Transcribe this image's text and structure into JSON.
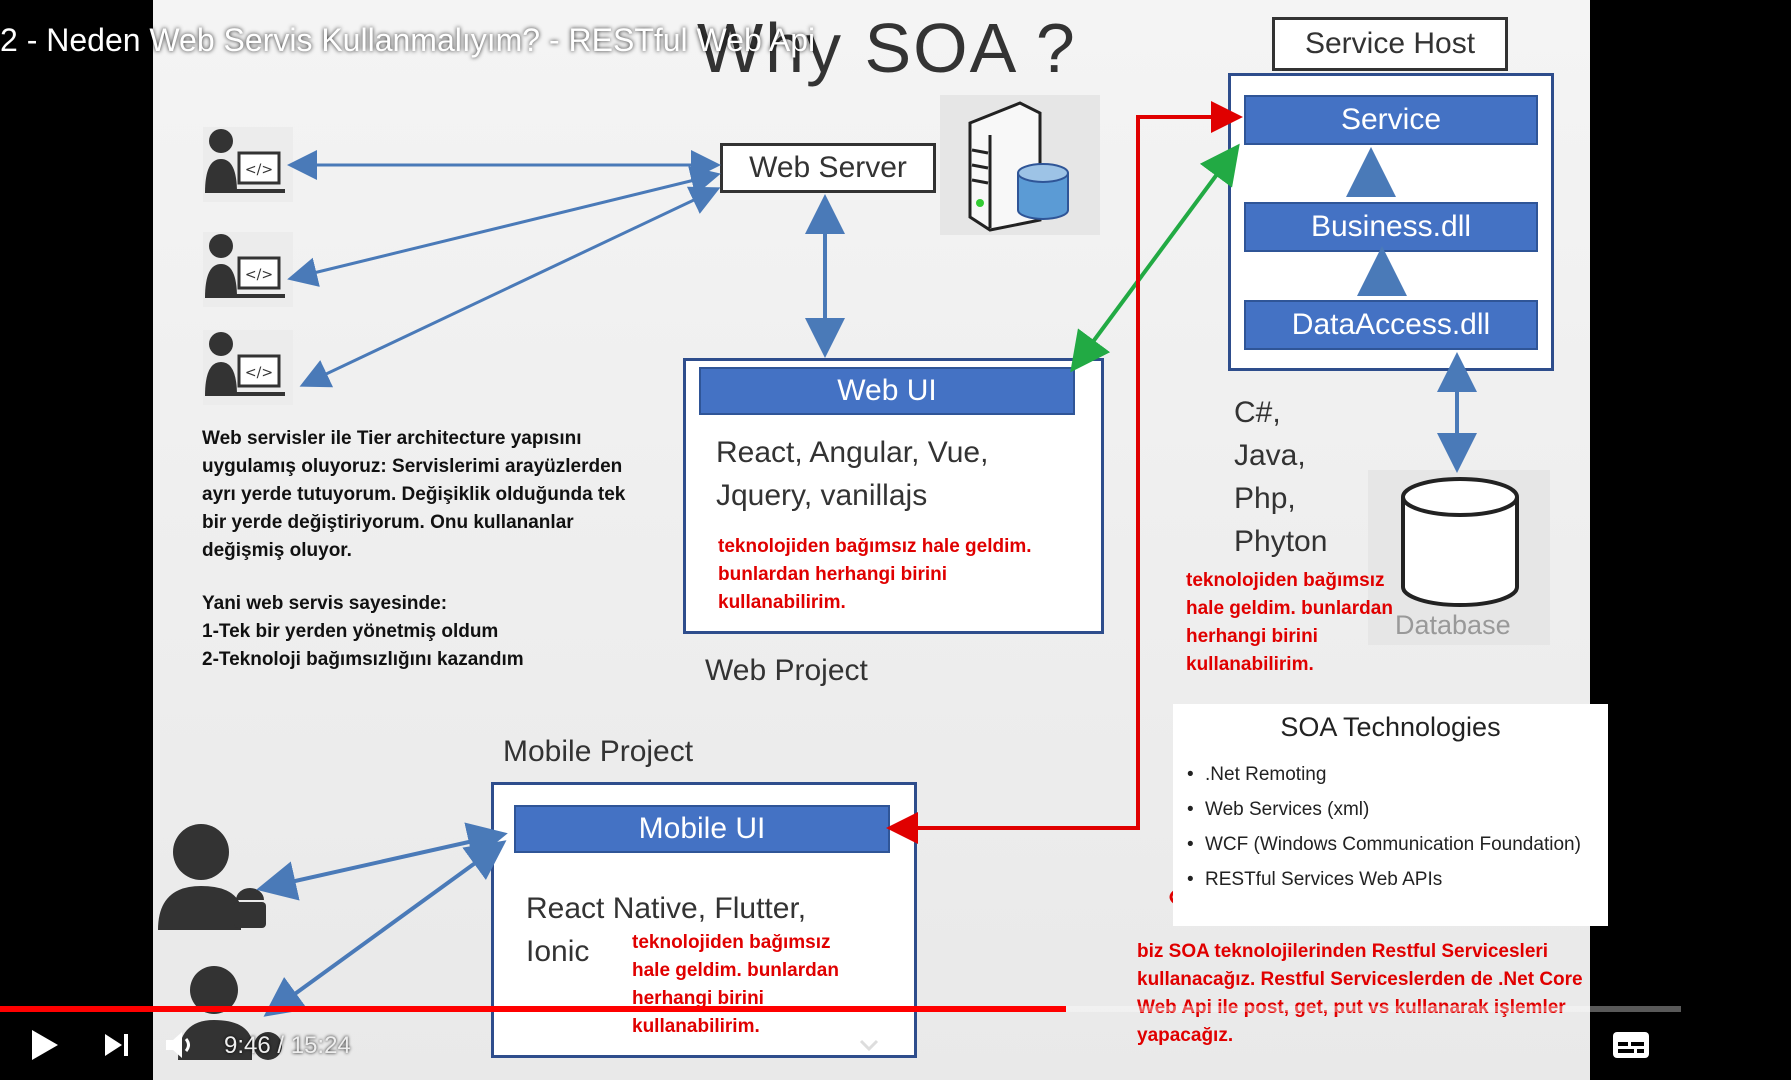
{
  "video": {
    "title": "2 - Neden Web Servis Kullanmalıyım? - RESTful Web Api",
    "current_time": "9:46",
    "separator": "/",
    "duration": "15:24",
    "progress_fraction": 0.634
  },
  "slide": {
    "heading": "Why SOA ?",
    "service_host": {
      "title": "Service Host",
      "service": "Service",
      "business": "Business.dll",
      "dataaccess": "DataAccess.dll"
    },
    "web_server": "Web Server",
    "web_project": {
      "ui": "Web UI",
      "tech_line1": "React, Angular, Vue,",
      "tech_line2": "Jquery, vanillajs",
      "label": "Web Project"
    },
    "mobile_project": {
      "label": "Mobile Project",
      "ui": "Mobile UI",
      "tech_line1": "React Native, Flutter,",
      "tech_line2": "Ionic"
    },
    "languages": [
      "C#,",
      "Java,",
      "Php,",
      "Phyton"
    ],
    "database": "Database",
    "soa_technologies": {
      "title": "SOA Technologies",
      "items": [
        ".Net Remoting",
        "Web Services (xml)",
        "WCF (Windows Communication Foundation)",
        "RESTful Services Web APIs"
      ]
    }
  },
  "notes": {
    "left_paragraph": [
      "Web servisler ile Tier architecture  yapısını",
      "uygulamış oluyoruz: Servislerimi arayüzlerden",
      "ayrı yerde tutuyorum. Değişiklik olduğunda tek",
      "bir yerde değiştiriyorum. Onu kullananlar",
      "değişmiş oluyor."
    ],
    "left_list": [
      "Yani web servis sayesinde:",
      "1-Tek bir yerden yönetmiş oldum",
      "2-Teknoloji bağımsızlığını kazandım"
    ],
    "web_red": [
      "teknolojiden bağımsız hale geldim.",
      "bunlardan herhangi birini",
      "kullanabilirim."
    ],
    "lang_red": [
      "teknolojiden bağımsız",
      "hale geldim. bunlardan",
      "herhangi birini",
      "kullanabilirim."
    ],
    "mobile_red": [
      "teknolojiden bağımsız",
      "hale geldim. bunlardan",
      "herhangi birini",
      "kullanabilirim."
    ],
    "bottom_red": [
      "biz SOA teknolojilerinden Restful Servicesleri",
      "kullanacağız. Restful Serviceslerden de .Net Core",
      "Web Api ile post, get, put vs kullanarak işlemler",
      "yapacağız."
    ]
  },
  "colors": {
    "progress": "#ff0000",
    "bar_blue": "#4472c4",
    "frame_blue": "#2e4d8c",
    "arrow_blue": "#4a7ab8",
    "arrow_green": "#22aa44",
    "annot_red": "#e00000"
  },
  "icons": [
    "developer-icon",
    "server-icon",
    "database-icon",
    "android-user-icon",
    "apple-user-icon",
    "play-icon",
    "next-icon",
    "volume-icon",
    "subtitles-icon",
    "chevron-down-icon"
  ]
}
